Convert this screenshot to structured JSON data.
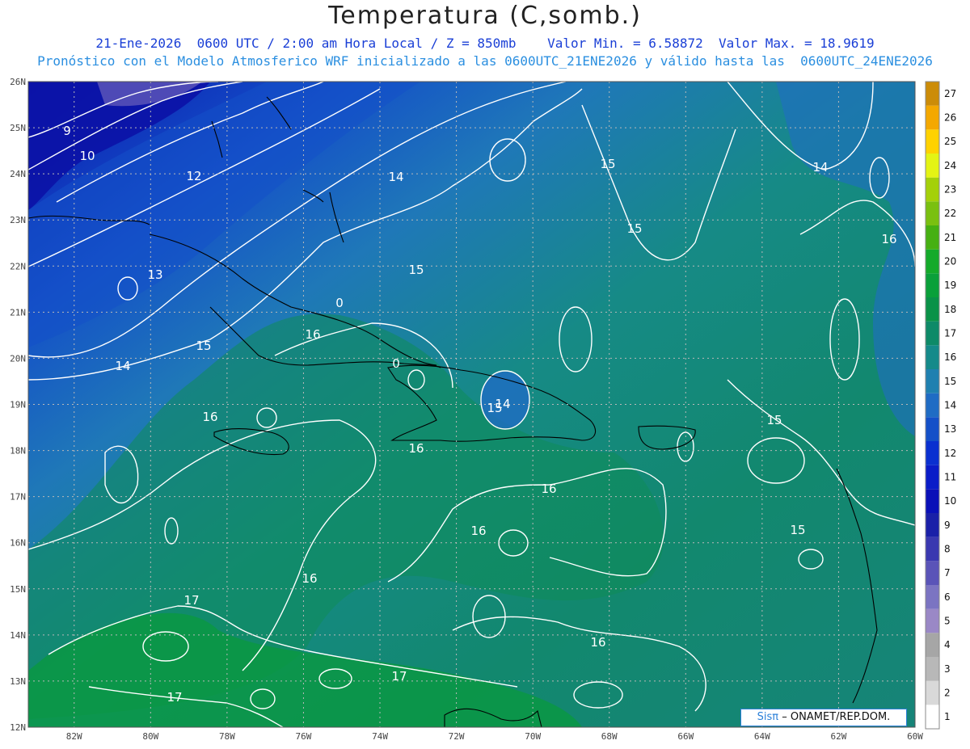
{
  "title": "Temperatura (C,somb.)",
  "subtitle_line1": "21-Ene-2026  0600 UTC / 2:00 am Hora Local / Z = 850mb    Valor Min. = 6.58872  Valor Max. = 18.9619",
  "subtitle_line2": "Pronóstico con el Modelo Atmosferico WRF inicializado a las 0600UTC_21ENE2026 y válido hasta las  0600UTC_24ENE2026",
  "map": {
    "lon_range": [
      -83.2,
      -60
    ],
    "lat_range": [
      12,
      26
    ],
    "lon_ticks": [
      "82W",
      "80W",
      "78W",
      "76W",
      "74W",
      "72W",
      "70W",
      "68W",
      "66W",
      "64W",
      "62W",
      "60W"
    ],
    "lat_ticks": [
      "12N",
      "13N",
      "14N",
      "15N",
      "16N",
      "17N",
      "18N",
      "19N",
      "20N",
      "21N",
      "22N",
      "23N",
      "24N",
      "25N",
      "26N"
    ],
    "grid_style": "dotted",
    "contour_labels": [
      "9",
      "10",
      "12",
      "14",
      "15",
      "14",
      "13",
      "15",
      "15",
      "0",
      "16",
      "14",
      "15",
      "0",
      "16",
      "16",
      "16",
      "16",
      "15",
      "15",
      "16",
      "16",
      "16",
      "17",
      "17",
      "17",
      "14",
      "15"
    ]
  },
  "colorbar": {
    "labels": [
      "1",
      "2",
      "3",
      "4",
      "5",
      "6",
      "7",
      "8",
      "9",
      "10",
      "11",
      "12",
      "13",
      "14",
      "15",
      "16",
      "17",
      "18",
      "19",
      "20",
      "21",
      "22",
      "23",
      "24",
      "25",
      "26",
      "27"
    ],
    "colors": [
      "#ffffff",
      "#d9d9d9",
      "#b8b8b8",
      "#a6a6a6",
      "#9a88c6",
      "#7b74c2",
      "#5a54b8",
      "#3a38b0",
      "#1a20a8",
      "#0a10b8",
      "#0a1cc8",
      "#0a30d0",
      "#1450c8",
      "#1f6cc4",
      "#1f80b0",
      "#158a8a",
      "#0e8a68",
      "#0a9248",
      "#0aa03a",
      "#14aa2a",
      "#46b012",
      "#7ac010",
      "#a4d00a",
      "#e4f414",
      "#ffd200",
      "#f4a800",
      "#cc8c08"
    ]
  },
  "credit": {
    "brand": "Sisπ",
    "text": "– ONAMET/REP.DOM."
  }
}
